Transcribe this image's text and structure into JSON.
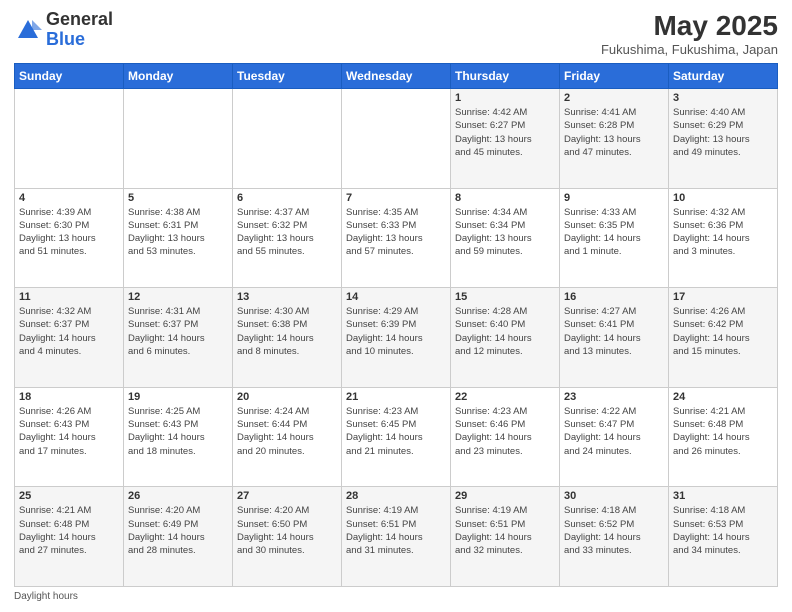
{
  "logo": {
    "general": "General",
    "blue": "Blue"
  },
  "header": {
    "month": "May 2025",
    "location": "Fukushima, Fukushima, Japan"
  },
  "days_of_week": [
    "Sunday",
    "Monday",
    "Tuesday",
    "Wednesday",
    "Thursday",
    "Friday",
    "Saturday"
  ],
  "footer": {
    "daylight_label": "Daylight hours"
  },
  "weeks": [
    [
      {
        "num": "",
        "info": ""
      },
      {
        "num": "",
        "info": ""
      },
      {
        "num": "",
        "info": ""
      },
      {
        "num": "",
        "info": ""
      },
      {
        "num": "1",
        "info": "Sunrise: 4:42 AM\nSunset: 6:27 PM\nDaylight: 13 hours\nand 45 minutes."
      },
      {
        "num": "2",
        "info": "Sunrise: 4:41 AM\nSunset: 6:28 PM\nDaylight: 13 hours\nand 47 minutes."
      },
      {
        "num": "3",
        "info": "Sunrise: 4:40 AM\nSunset: 6:29 PM\nDaylight: 13 hours\nand 49 minutes."
      }
    ],
    [
      {
        "num": "4",
        "info": "Sunrise: 4:39 AM\nSunset: 6:30 PM\nDaylight: 13 hours\nand 51 minutes."
      },
      {
        "num": "5",
        "info": "Sunrise: 4:38 AM\nSunset: 6:31 PM\nDaylight: 13 hours\nand 53 minutes."
      },
      {
        "num": "6",
        "info": "Sunrise: 4:37 AM\nSunset: 6:32 PM\nDaylight: 13 hours\nand 55 minutes."
      },
      {
        "num": "7",
        "info": "Sunrise: 4:35 AM\nSunset: 6:33 PM\nDaylight: 13 hours\nand 57 minutes."
      },
      {
        "num": "8",
        "info": "Sunrise: 4:34 AM\nSunset: 6:34 PM\nDaylight: 13 hours\nand 59 minutes."
      },
      {
        "num": "9",
        "info": "Sunrise: 4:33 AM\nSunset: 6:35 PM\nDaylight: 14 hours\nand 1 minute."
      },
      {
        "num": "10",
        "info": "Sunrise: 4:32 AM\nSunset: 6:36 PM\nDaylight: 14 hours\nand 3 minutes."
      }
    ],
    [
      {
        "num": "11",
        "info": "Sunrise: 4:32 AM\nSunset: 6:37 PM\nDaylight: 14 hours\nand 4 minutes."
      },
      {
        "num": "12",
        "info": "Sunrise: 4:31 AM\nSunset: 6:37 PM\nDaylight: 14 hours\nand 6 minutes."
      },
      {
        "num": "13",
        "info": "Sunrise: 4:30 AM\nSunset: 6:38 PM\nDaylight: 14 hours\nand 8 minutes."
      },
      {
        "num": "14",
        "info": "Sunrise: 4:29 AM\nSunset: 6:39 PM\nDaylight: 14 hours\nand 10 minutes."
      },
      {
        "num": "15",
        "info": "Sunrise: 4:28 AM\nSunset: 6:40 PM\nDaylight: 14 hours\nand 12 minutes."
      },
      {
        "num": "16",
        "info": "Sunrise: 4:27 AM\nSunset: 6:41 PM\nDaylight: 14 hours\nand 13 minutes."
      },
      {
        "num": "17",
        "info": "Sunrise: 4:26 AM\nSunset: 6:42 PM\nDaylight: 14 hours\nand 15 minutes."
      }
    ],
    [
      {
        "num": "18",
        "info": "Sunrise: 4:26 AM\nSunset: 6:43 PM\nDaylight: 14 hours\nand 17 minutes."
      },
      {
        "num": "19",
        "info": "Sunrise: 4:25 AM\nSunset: 6:43 PM\nDaylight: 14 hours\nand 18 minutes."
      },
      {
        "num": "20",
        "info": "Sunrise: 4:24 AM\nSunset: 6:44 PM\nDaylight: 14 hours\nand 20 minutes."
      },
      {
        "num": "21",
        "info": "Sunrise: 4:23 AM\nSunset: 6:45 PM\nDaylight: 14 hours\nand 21 minutes."
      },
      {
        "num": "22",
        "info": "Sunrise: 4:23 AM\nSunset: 6:46 PM\nDaylight: 14 hours\nand 23 minutes."
      },
      {
        "num": "23",
        "info": "Sunrise: 4:22 AM\nSunset: 6:47 PM\nDaylight: 14 hours\nand 24 minutes."
      },
      {
        "num": "24",
        "info": "Sunrise: 4:21 AM\nSunset: 6:48 PM\nDaylight: 14 hours\nand 26 minutes."
      }
    ],
    [
      {
        "num": "25",
        "info": "Sunrise: 4:21 AM\nSunset: 6:48 PM\nDaylight: 14 hours\nand 27 minutes."
      },
      {
        "num": "26",
        "info": "Sunrise: 4:20 AM\nSunset: 6:49 PM\nDaylight: 14 hours\nand 28 minutes."
      },
      {
        "num": "27",
        "info": "Sunrise: 4:20 AM\nSunset: 6:50 PM\nDaylight: 14 hours\nand 30 minutes."
      },
      {
        "num": "28",
        "info": "Sunrise: 4:19 AM\nSunset: 6:51 PM\nDaylight: 14 hours\nand 31 minutes."
      },
      {
        "num": "29",
        "info": "Sunrise: 4:19 AM\nSunset: 6:51 PM\nDaylight: 14 hours\nand 32 minutes."
      },
      {
        "num": "30",
        "info": "Sunrise: 4:18 AM\nSunset: 6:52 PM\nDaylight: 14 hours\nand 33 minutes."
      },
      {
        "num": "31",
        "info": "Sunrise: 4:18 AM\nSunset: 6:53 PM\nDaylight: 14 hours\nand 34 minutes."
      }
    ]
  ]
}
